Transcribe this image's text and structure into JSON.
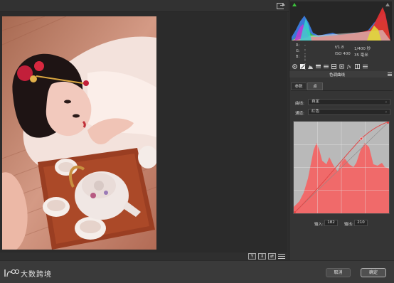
{
  "histogram": {
    "readout": {
      "r_label": "R:",
      "g_label": "G:",
      "b_label": "B:",
      "r_value": "----",
      "g_value": "----",
      "b_value": "----",
      "aperture": "f/1.8",
      "shutter": "1/400 秒",
      "iso": "ISO 400",
      "focal_length": "35 毫米"
    }
  },
  "panel": {
    "title": "色调曲线",
    "subtabs": [
      "参数",
      "点"
    ],
    "active_subtab": "点",
    "curve_label": "曲线:",
    "curve_value": "自定",
    "channel_label": "通道:",
    "channel_value": "红色",
    "input_label": "输入:",
    "input_value": "182",
    "output_label": "输出:",
    "output_value": "210"
  },
  "view_tools": {
    "compare_label": "Y"
  },
  "footer": {
    "logo_text": "大数跨境",
    "cancel_label": "取消",
    "ok_label": "确定"
  },
  "colors": {
    "curve_fill": "#f06a6a",
    "curve_line": "#e04848",
    "panel_bg": "#353535",
    "canvas_bg": "#2b2b2b"
  },
  "icons": [
    "export-icon",
    "basic-panel-icon",
    "tone-curve-icon",
    "hsl-icon",
    "split-toning-icon",
    "detail-icon",
    "lens-icon",
    "fx-icon",
    "camera-calibration-icon",
    "presets-icon"
  ]
}
